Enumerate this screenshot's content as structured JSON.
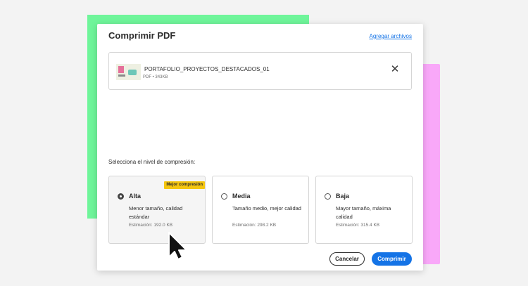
{
  "dialog": {
    "title": "Comprimir PDF",
    "add_files_label": "Agregar archivos"
  },
  "file": {
    "name": "PORTAFOLIO_PROYECTOS_DESTACADOS_01",
    "meta": "PDF • 343KB"
  },
  "compression": {
    "prompt": "Selecciona el nivel de compresión:",
    "selected": "Alta",
    "options": [
      {
        "title": "Alta",
        "badge": "Mejor compresión",
        "description": "Menor tamaño, calidad estándar",
        "estimate": "Estimación: 192.0 KB"
      },
      {
        "title": "Media",
        "description": "Tamaño medio, mejor calidad",
        "estimate": "Estimación: 298.2 KB"
      },
      {
        "title": "Baja",
        "description": "Mayor tamaño, máxima calidad",
        "estimate": "Estimación: 315.4 KB"
      }
    ]
  },
  "actions": {
    "cancel_label": "Cancelar",
    "compress_label": "Comprimir"
  },
  "colors": {
    "accent": "#1473e6",
    "badge": "#f5c60f",
    "decor_green": "#6ff59a",
    "decor_pink": "#f9a8f9"
  },
  "icons": {
    "close": "close-icon",
    "cursor": "pointer-cursor-icon"
  }
}
